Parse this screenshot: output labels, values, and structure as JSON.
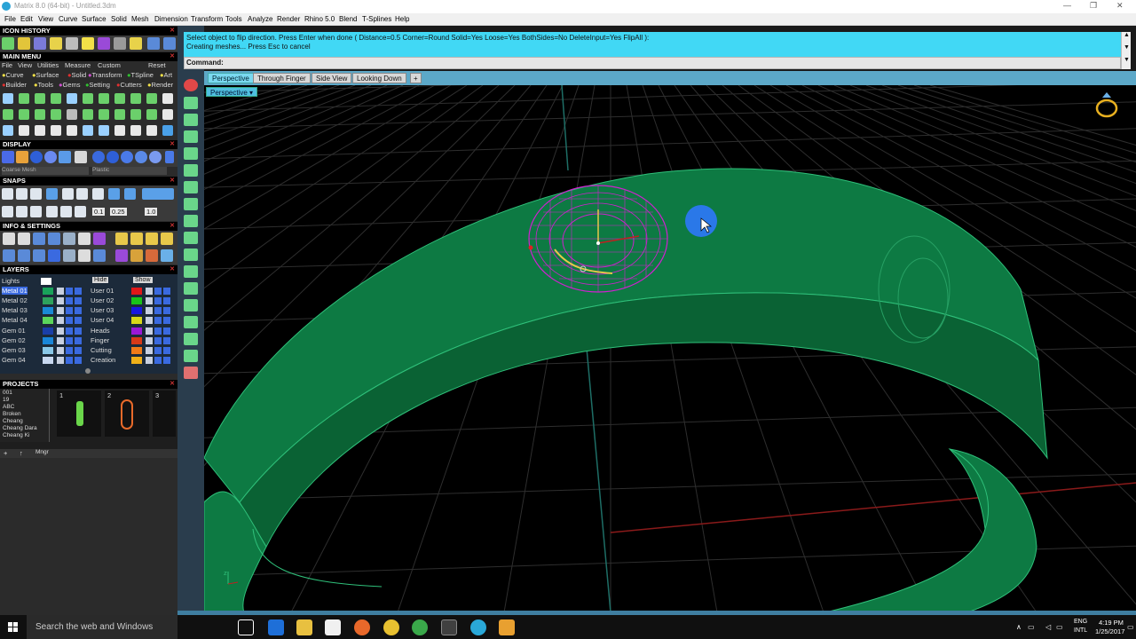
{
  "window": {
    "title": "Matrix 8.0 (64-bit) - Untitled.3dm",
    "controls": [
      "—",
      "❐",
      "✕"
    ]
  },
  "menu": [
    "File",
    "Edit",
    "View",
    "Curve",
    "Surface",
    "Solid",
    "Mesh",
    "Dimension",
    "Transform",
    "Tools",
    "Analyze",
    "Render",
    "Rhino 5.0",
    "Blend",
    "T-Splines",
    "Help"
  ],
  "left_panel": {
    "icon_history": "ICON HISTORY",
    "main_menu": "MAIN MENU",
    "main_menu_row1": [
      "File",
      "View",
      "Utilities",
      "Measure",
      "Custom"
    ],
    "main_menu_reset": "Reset",
    "main_menu_row2": [
      "Curve",
      "Surface",
      "Solid",
      "TSpline",
      "Art"
    ],
    "main_menu_row3": [
      "Builder",
      "Tools",
      "Gems",
      "Setting",
      "Cutters",
      "Render"
    ],
    "display": "DISPLAY",
    "display_select1": "Coarse Mesh",
    "display_select2": "Plastic",
    "snaps": "SNAPS",
    "snap_values": [
      "0.1",
      "0.25",
      "1.0"
    ],
    "info_settings": "INFO & SETTINGS",
    "layers": "LAYERS",
    "lights": "Lights",
    "hide": "Hide",
    "show": "Show",
    "layer_left": [
      "Metal 01",
      "Metal 02",
      "Metal 03",
      "Metal 04",
      "Gem 01",
      "Gem 02",
      "Gem 03",
      "Gem 04"
    ],
    "layer_right": [
      "User 01",
      "User 02",
      "User 03",
      "User 04",
      "Heads",
      "Finger",
      "Cutting",
      "Creation"
    ],
    "layer_left_colors": [
      "#19a35a",
      "#2ea35c",
      "#1a8ad6",
      "#5bd65b",
      "#1a3fa8",
      "#1a86d8",
      "#8ac8e8",
      "#c8d8f0"
    ],
    "layer_right_colors": [
      "#e01818",
      "#19c319",
      "#1818e0",
      "#d8d818",
      "#9a18d8",
      "#d83a18",
      "#f07b18",
      "#f0b018"
    ],
    "projects": "PROJECTS",
    "project_list": [
      "001",
      "19",
      "ABC",
      "Broken",
      "Cheang",
      "Cheang Dara",
      "Cheang Ki"
    ],
    "project_numbers": [
      "1",
      "2",
      "3"
    ],
    "mngr": "Mngr"
  },
  "command": {
    "line1": "Select object to flip direction. Press Enter when done ( Distance=0.5  Corner=Round  Solid=Yes  Loose=Yes  BothSides=No  DeleteInput=Yes  FlipAll ):",
    "line2": "Creating meshes... Press Esc to cancel",
    "prompt_label": "Command:",
    "prompt_value": ""
  },
  "tabs": [
    "Perspective",
    "Through Finger",
    "Side View",
    "Looking Down"
  ],
  "tab_add": "+",
  "viewport": {
    "label": "Perspective",
    "ring_color": "#0f8a4c",
    "ring_edge_color": "#2fc07a",
    "selection_color": "#d020d0",
    "grid_color": "#2e2e2e"
  },
  "taskbar": {
    "search_placeholder": "Search the web and Windows",
    "lang": "ENG",
    "layout": "INTL",
    "time": "4:19 PM",
    "date": "1/25/2017"
  }
}
